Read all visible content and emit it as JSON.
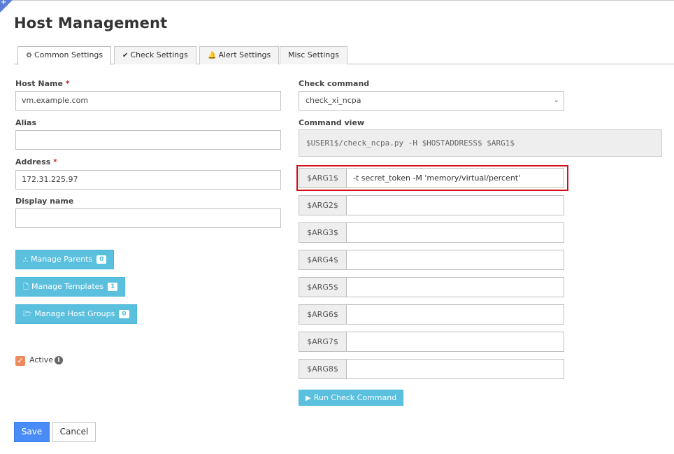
{
  "page": {
    "title": "Host Management"
  },
  "tabs": [
    {
      "label": "Common Settings",
      "icon": "gear-icon",
      "active": true
    },
    {
      "label": "Check Settings",
      "icon": "check-icon",
      "active": false
    },
    {
      "label": "Alert Settings",
      "icon": "bell-icon",
      "active": false
    },
    {
      "label": "Misc Settings",
      "icon": "",
      "active": false
    }
  ],
  "form": {
    "host_name": {
      "label": "Host Name",
      "required_mark": "*",
      "value": "vm.example.com"
    },
    "alias": {
      "label": "Alias",
      "value": ""
    },
    "address": {
      "label": "Address",
      "required_mark": "*",
      "value": "172.31.225.97"
    },
    "display_name": {
      "label": "Display name",
      "value": ""
    },
    "manage_parents": {
      "label": "Manage Parents",
      "count": "0",
      "icon": "sitemap-icon"
    },
    "manage_templates": {
      "label": "Manage Templates",
      "count": "1",
      "icon": "file-icon"
    },
    "manage_host_groups": {
      "label": "Manage Host Groups",
      "count": "0",
      "icon": "folder-open-icon"
    },
    "active": {
      "label": "Active",
      "checked": true
    }
  },
  "check": {
    "command_label": "Check command",
    "command_value": "check_xi_ncpa",
    "view_label": "Command view",
    "view_value": "$USER1$/check_ncpa.py -H $HOSTADDRESS$ $ARG1$",
    "args": [
      {
        "name": "$ARG1$",
        "value": "-t secret_token -M 'memory/virtual/percent'"
      },
      {
        "name": "$ARG2$",
        "value": ""
      },
      {
        "name": "$ARG3$",
        "value": ""
      },
      {
        "name": "$ARG4$",
        "value": ""
      },
      {
        "name": "$ARG5$",
        "value": ""
      },
      {
        "name": "$ARG6$",
        "value": ""
      },
      {
        "name": "$ARG7$",
        "value": ""
      },
      {
        "name": "$ARG8$",
        "value": ""
      }
    ],
    "run_label": "Run Check Command"
  },
  "actions": {
    "save": "Save",
    "cancel": "Cancel"
  },
  "colors": {
    "accent_blue": "#5bc0de",
    "save_blue": "#4a8cf7",
    "highlight_red": "#d0111a",
    "checkbox_orange": "#ef8a5f"
  }
}
